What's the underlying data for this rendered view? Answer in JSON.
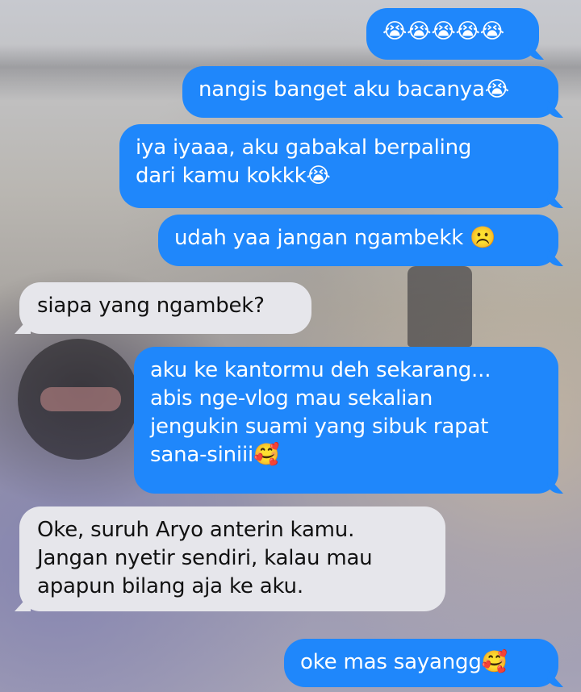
{
  "messages": [
    {
      "direction": "outgoing",
      "text": "😭😭😭😭😭"
    },
    {
      "direction": "outgoing",
      "text": "nangis banget aku bacanya😭"
    },
    {
      "direction": "outgoing",
      "text": "iya iyaaa, aku gabakal berpaling\ndari kamu kokkk😭"
    },
    {
      "direction": "outgoing",
      "text": "udah yaa jangan ngambekk ☹️"
    },
    {
      "direction": "incoming",
      "text": "siapa yang ngambek?"
    },
    {
      "direction": "outgoing",
      "text": "aku ke kantormu deh sekarang...\nabis nge-vlog mau sekalian\njengukin suami yang sibuk rapat\nsana-siniii🥰"
    },
    {
      "direction": "incoming",
      "text": "Oke, suruh Aryo anterin kamu.\nJangan nyetir sendiri, kalau mau\napapun bilang aja ke aku."
    },
    {
      "direction": "outgoing",
      "text": "oke mas sayangg🥰"
    }
  ],
  "colors": {
    "outgoing_bubble": "#1f87fb",
    "incoming_bubble": "#e6e6eb",
    "outgoing_text": "#ffffff",
    "incoming_text": "#111111"
  }
}
